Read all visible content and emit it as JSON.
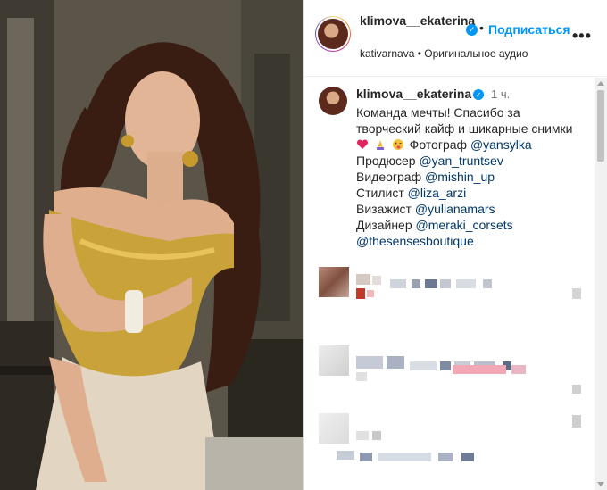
{
  "header": {
    "username": "klimova__ekaterina",
    "follow_label": "Подписаться",
    "separator": "•",
    "more_label": "•••",
    "subline": "kativarnava • Оригинальное аудио"
  },
  "caption": {
    "username": "klimova__ekaterina",
    "time": "1 ч.",
    "line1": "Команда мечты! Спасибо за",
    "line2": "творческий кайф и шикарные снимки",
    "photographer_label": "Фотограф",
    "photographer": "@yansylka",
    "producer_label": "Продюсер",
    "producer": "@yan_truntsev",
    "videographer_label": "Видеограф",
    "videographer": "@mishin_up",
    "stylist_label": "Стилист",
    "stylist": "@liza_arzi",
    "makeup_label": "Визажист",
    "makeup": "@yulianamars",
    "designer_label": "Дизайнер",
    "designer": "@meraki_corsets",
    "boutique": "@thesensesboutique"
  },
  "icons": {
    "verified": "verified-badge-icon",
    "heart": "red-heart-icon",
    "pray": "folded-hands-icon",
    "wink": "winking-tongue-face-icon",
    "more": "more-dots-icon"
  },
  "colors": {
    "accent": "#0095f6",
    "mention": "#00376b",
    "muted": "#737373",
    "text": "#262626"
  }
}
